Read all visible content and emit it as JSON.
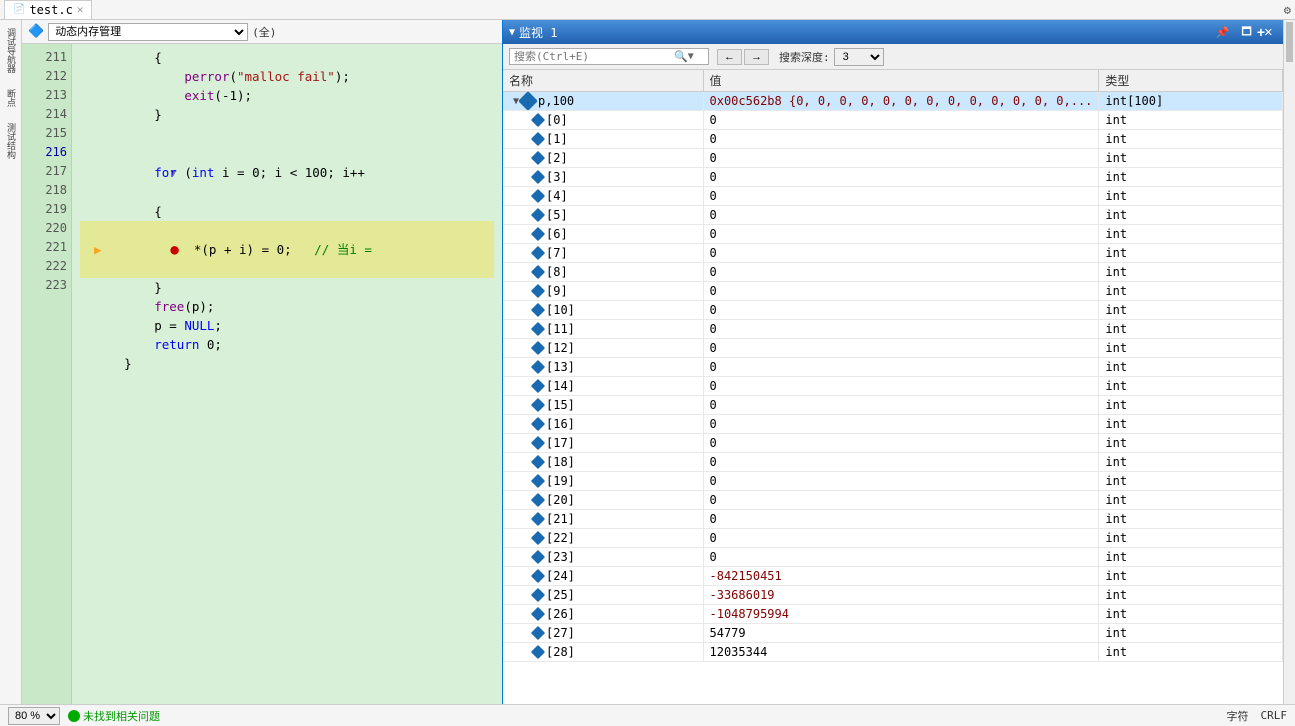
{
  "topBar": {
    "tab": {
      "label": "test.c",
      "icon": "📄"
    }
  },
  "editorToolbar": {
    "dropdown": "动态内存管理",
    "fullLabel": "(全)"
  },
  "watchPanel": {
    "title": "监视 1",
    "searchPlaceholder": "搜索(Ctrl+E)",
    "depthLabel": "搜索深度:",
    "depthValue": "3",
    "columns": [
      "名称",
      "值",
      "类型"
    ],
    "items": [
      {
        "name": "p,100",
        "value": "0x00c562b8 {0, 0, 0, 0, 0, 0, 0, 0, 0, 0, 0, 0, 0,...",
        "type": "int[100]",
        "expanded": true,
        "level": 0,
        "hasChildren": true
      },
      {
        "name": "[0]",
        "value": "0",
        "type": "int",
        "level": 1
      },
      {
        "name": "[1]",
        "value": "0",
        "type": "int",
        "level": 1
      },
      {
        "name": "[2]",
        "value": "0",
        "type": "int",
        "level": 1
      },
      {
        "name": "[3]",
        "value": "0",
        "type": "int",
        "level": 1
      },
      {
        "name": "[4]",
        "value": "0",
        "type": "int",
        "level": 1
      },
      {
        "name": "[5]",
        "value": "0",
        "type": "int",
        "level": 1
      },
      {
        "name": "[6]",
        "value": "0",
        "type": "int",
        "level": 1
      },
      {
        "name": "[7]",
        "value": "0",
        "type": "int",
        "level": 1
      },
      {
        "name": "[8]",
        "value": "0",
        "type": "int",
        "level": 1
      },
      {
        "name": "[9]",
        "value": "0",
        "type": "int",
        "level": 1
      },
      {
        "name": "[10]",
        "value": "0",
        "type": "int",
        "level": 1
      },
      {
        "name": "[11]",
        "value": "0",
        "type": "int",
        "level": 1
      },
      {
        "name": "[12]",
        "value": "0",
        "type": "int",
        "level": 1
      },
      {
        "name": "[13]",
        "value": "0",
        "type": "int",
        "level": 1
      },
      {
        "name": "[14]",
        "value": "0",
        "type": "int",
        "level": 1
      },
      {
        "name": "[15]",
        "value": "0",
        "type": "int",
        "level": 1
      },
      {
        "name": "[16]",
        "value": "0",
        "type": "int",
        "level": 1
      },
      {
        "name": "[17]",
        "value": "0",
        "type": "int",
        "level": 1
      },
      {
        "name": "[18]",
        "value": "0",
        "type": "int",
        "level": 1
      },
      {
        "name": "[19]",
        "value": "0",
        "type": "int",
        "level": 1
      },
      {
        "name": "[20]",
        "value": "0",
        "type": "int",
        "level": 1
      },
      {
        "name": "[21]",
        "value": "0",
        "type": "int",
        "level": 1
      },
      {
        "name": "[22]",
        "value": "0",
        "type": "int",
        "level": 1
      },
      {
        "name": "[23]",
        "value": "0",
        "type": "int",
        "level": 1
      },
      {
        "name": "[24]",
        "value": "-842150451",
        "type": "int",
        "level": 1
      },
      {
        "name": "[25]",
        "value": "-33686019",
        "type": "int",
        "level": 1
      },
      {
        "name": "[26]",
        "value": "-1048795994",
        "type": "int",
        "level": 1
      },
      {
        "name": "[27]",
        "value": "54779",
        "type": "int",
        "level": 1
      },
      {
        "name": "[28]",
        "value": "12035344",
        "type": "int",
        "level": 1
      }
    ]
  },
  "code": {
    "lines": [
      {
        "num": "211",
        "text": "        {",
        "indent": 0
      },
      {
        "num": "212",
        "text": "            perror(\"malloc fail\");",
        "indent": 0
      },
      {
        "num": "213",
        "text": "            exit(-1);",
        "indent": 0
      },
      {
        "num": "214",
        "text": "        }",
        "indent": 0
      },
      {
        "num": "215",
        "text": "",
        "indent": 0
      },
      {
        "num": "216",
        "text": "        for (int i = 0; i < 100; i++",
        "indent": 0,
        "hasFold": true
      },
      {
        "num": "217",
        "text": "        {",
        "indent": 0
      },
      {
        "num": "218",
        "text": "            *(p + i) = 0;   // 当i =",
        "indent": 0,
        "breakpoint": true,
        "active": true
      },
      {
        "num": "219",
        "text": "        }",
        "indent": 0
      },
      {
        "num": "220",
        "text": "        free(p);",
        "indent": 0
      },
      {
        "num": "221",
        "text": "        p = NULL;",
        "indent": 0
      },
      {
        "num": "222",
        "text": "        return 0;",
        "indent": 0
      },
      {
        "num": "223",
        "text": "    }",
        "indent": 0
      }
    ]
  },
  "bottomBar": {
    "zoom": "80 %",
    "status": "未找到相关问题",
    "encoding": "字符",
    "lineEnding": "CRLF"
  },
  "rightPanel": {
    "addLabel": "+"
  },
  "leftSidebarIcons": [
    "调",
    "试",
    "导",
    "航",
    "器",
    "断",
    "点",
    "测",
    "试",
    "结",
    "构"
  ]
}
